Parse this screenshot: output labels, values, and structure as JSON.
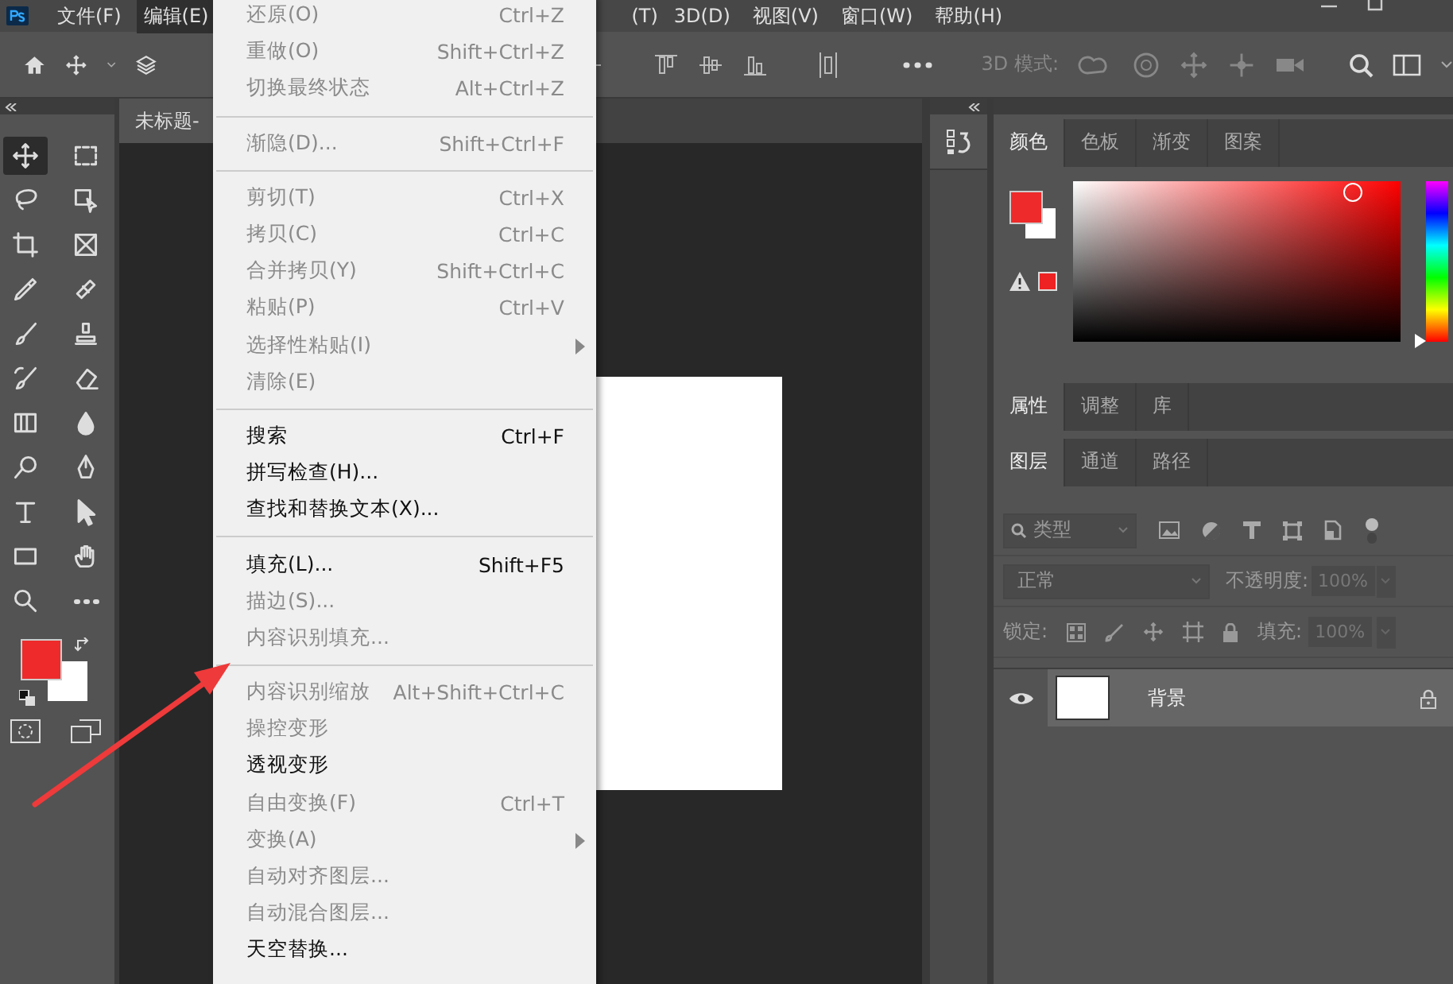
{
  "menubar": {
    "items": [
      {
        "label": "文件(F)",
        "selected": false
      },
      {
        "label": "编辑(E)",
        "selected": true
      },
      {
        "label": "(T)",
        "selected": false
      },
      {
        "label": "3D(D)",
        "selected": false
      },
      {
        "label": "视图(V)",
        "selected": false
      },
      {
        "label": "窗口(W)",
        "selected": false
      },
      {
        "label": "帮助(H)",
        "selected": false
      }
    ]
  },
  "options_bar": {
    "mode_label": "3D 模式:"
  },
  "document_tab": {
    "title": "未标题-"
  },
  "tools": [
    {
      "kind": "move",
      "selected": true
    },
    {
      "kind": "marquee",
      "selected": false
    },
    {
      "kind": "lasso",
      "selected": false
    },
    {
      "kind": "object-select",
      "selected": false
    },
    {
      "kind": "crop",
      "selected": false
    },
    {
      "kind": "frame",
      "selected": false
    },
    {
      "kind": "eyedropper",
      "selected": false
    },
    {
      "kind": "bandage",
      "selected": false
    },
    {
      "kind": "brush",
      "selected": false
    },
    {
      "kind": "stamp",
      "selected": false
    },
    {
      "kind": "history-brush",
      "selected": false
    },
    {
      "kind": "eraser",
      "selected": false
    },
    {
      "kind": "gradient",
      "selected": false
    },
    {
      "kind": "drop",
      "selected": false
    },
    {
      "kind": "dodge",
      "selected": false
    },
    {
      "kind": "pen",
      "selected": false
    },
    {
      "kind": "type",
      "selected": false
    },
    {
      "kind": "path-select",
      "selected": false
    },
    {
      "kind": "rectangle",
      "selected": false
    },
    {
      "kind": "hand",
      "selected": false
    },
    {
      "kind": "zoom",
      "selected": false
    },
    {
      "kind": "more",
      "selected": false
    }
  ],
  "edit_menu": {
    "groups": [
      {
        "items": [
          {
            "label": "还原(O)",
            "shortcut": "Ctrl+Z",
            "enabled": false,
            "submenu": false
          },
          {
            "label": "重做(O)",
            "shortcut": "Shift+Ctrl+Z",
            "enabled": false,
            "submenu": false
          },
          {
            "label": "切换最终状态",
            "shortcut": "Alt+Ctrl+Z",
            "enabled": false,
            "submenu": false
          }
        ]
      },
      {
        "items": [
          {
            "label": "渐隐(D)...",
            "shortcut": "Shift+Ctrl+F",
            "enabled": false,
            "submenu": false
          }
        ]
      },
      {
        "items": [
          {
            "label": "剪切(T)",
            "shortcut": "Ctrl+X",
            "enabled": false,
            "submenu": false
          },
          {
            "label": "拷贝(C)",
            "shortcut": "Ctrl+C",
            "enabled": false,
            "submenu": false
          },
          {
            "label": "合并拷贝(Y)",
            "shortcut": "Shift+Ctrl+C",
            "enabled": false,
            "submenu": false
          },
          {
            "label": "粘贴(P)",
            "shortcut": "Ctrl+V",
            "enabled": false,
            "submenu": false
          },
          {
            "label": "选择性粘贴(I)",
            "enabled": false,
            "submenu": true
          },
          {
            "label": "清除(E)",
            "enabled": false,
            "submenu": false
          }
        ]
      },
      {
        "items": [
          {
            "label": "搜索",
            "shortcut": "Ctrl+F",
            "enabled": true,
            "submenu": false
          },
          {
            "label": "拼写检查(H)...",
            "enabled": true,
            "submenu": false
          },
          {
            "label": "查找和替换文本(X)...",
            "enabled": true,
            "submenu": false
          }
        ]
      },
      {
        "items": [
          {
            "label": "填充(L)...",
            "shortcut": "Shift+F5",
            "enabled": true,
            "submenu": false
          },
          {
            "label": "描边(S)...",
            "enabled": false,
            "submenu": false
          },
          {
            "label": "内容识别填充...",
            "enabled": false,
            "submenu": false
          }
        ]
      },
      {
        "items": [
          {
            "label": "内容识别缩放",
            "shortcut": "Alt+Shift+Ctrl+C",
            "enabled": false,
            "submenu": false
          },
          {
            "label": "操控变形",
            "enabled": false,
            "submenu": false
          },
          {
            "label": "透视变形",
            "enabled": true,
            "submenu": false
          },
          {
            "label": "自由变换(F)",
            "shortcut": "Ctrl+T",
            "enabled": false,
            "submenu": false
          },
          {
            "label": "变换(A)",
            "enabled": false,
            "submenu": true
          },
          {
            "label": "自动对齐图层...",
            "enabled": false,
            "submenu": false
          },
          {
            "label": "自动混合图层...",
            "enabled": false,
            "submenu": false
          },
          {
            "label": "天空替换...",
            "enabled": true,
            "submenu": false
          }
        ]
      }
    ]
  },
  "color_panel": {
    "tabs": [
      {
        "label": "颜色",
        "selected": true
      },
      {
        "label": "色板",
        "selected": false
      },
      {
        "label": "渐变",
        "selected": false
      },
      {
        "label": "图案",
        "selected": false
      }
    ]
  },
  "hue_slider": {
    "level": 0
  },
  "properties_panel": {
    "tabs": [
      {
        "label": "属性",
        "selected": true
      },
      {
        "label": "调整",
        "selected": false
      },
      {
        "label": "库",
        "selected": false
      }
    ]
  },
  "layers_panel": {
    "tabs": [
      {
        "label": "图层",
        "selected": true
      },
      {
        "label": "通道",
        "selected": false
      },
      {
        "label": "路径",
        "selected": false
      }
    ],
    "filter": {
      "value": "类型"
    },
    "blend_mode": {
      "value": "正常"
    },
    "opacity": {
      "label": "不透明度:",
      "value": "100%"
    },
    "lock_label": "锁定:",
    "fill": {
      "label": "填充:",
      "value": "100%"
    },
    "layers": [
      {
        "name": "背景",
        "visible": true,
        "locked": true,
        "selected": true
      }
    ]
  }
}
